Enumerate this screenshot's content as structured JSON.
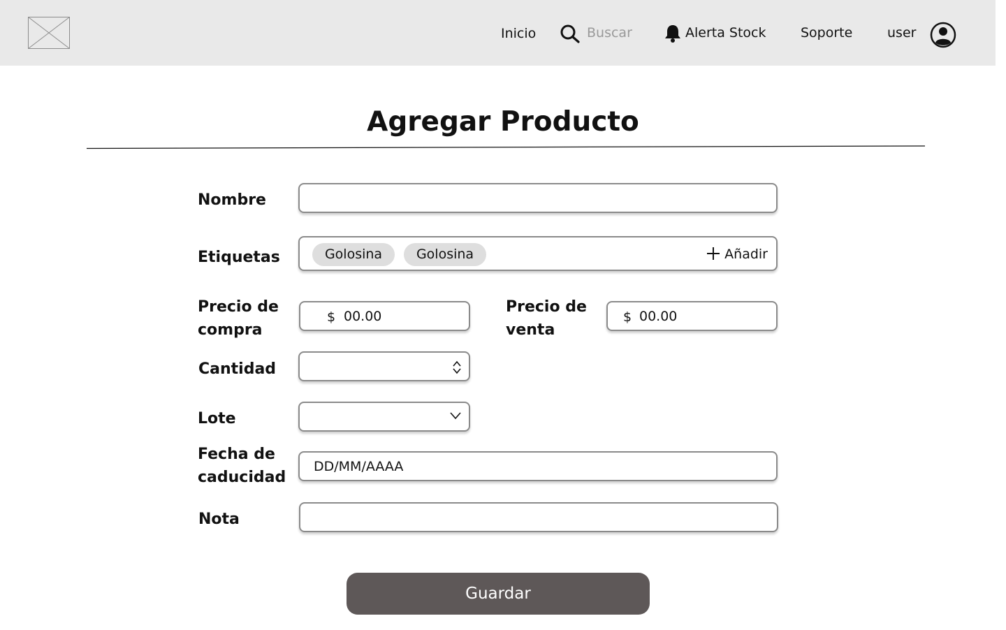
{
  "nav": {
    "logo": "logo-placeholder",
    "home_label": "Inicio",
    "search_placeholder": "Buscar",
    "alert_label": "Alerta Stock",
    "support_label": "Soporte",
    "user_label": "user",
    "icons": [
      "search-icon",
      "bell-icon",
      "user-avatar-icon"
    ]
  },
  "page": {
    "title": "Agregar Producto"
  },
  "form": {
    "name": {
      "label": "Nombre",
      "value": ""
    },
    "tags": {
      "label": "Etiquetas",
      "items": [
        "Golosina",
        "Golosina"
      ],
      "add_label": "Añadir"
    },
    "purchase_price": {
      "label_line1": "Precio de",
      "label_line2": "compra",
      "currency": "$",
      "placeholder": "00.00"
    },
    "sale_price": {
      "label_line1": "Precio de",
      "label_line2": "venta",
      "currency": "$",
      "placeholder": "00.00"
    },
    "quantity": {
      "label": "Cantidad",
      "value": ""
    },
    "batch": {
      "label": "Lote",
      "value": ""
    },
    "expiry": {
      "label_line1": "Fecha de",
      "label_line2": "caducidad",
      "placeholder": "DD/MM/AAAA"
    },
    "note": {
      "label": "Nota",
      "value": ""
    },
    "save_label": "Guardar"
  },
  "colors": {
    "topbar": "#e9e9e9",
    "button": "#5e5858",
    "chip": "#dedede",
    "border": "#8a8a8a"
  }
}
